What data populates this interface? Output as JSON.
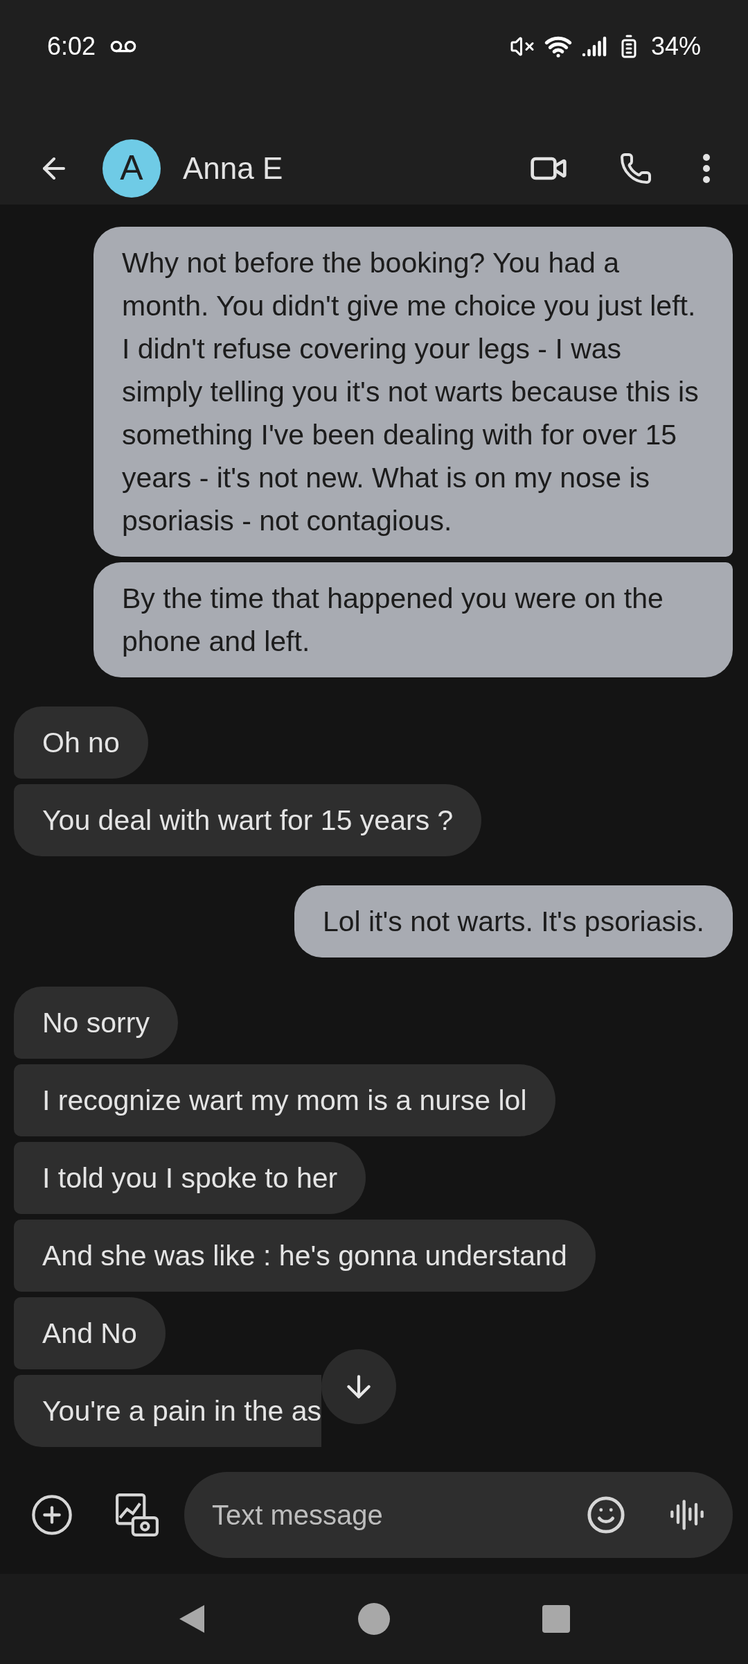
{
  "status_bar": {
    "time": "6:02",
    "battery": "34%"
  },
  "header": {
    "avatar_letter": "A",
    "contact_name": "Anna E"
  },
  "conversation": [
    {
      "kind": "sent",
      "messages": [
        "Why not before the booking? You had a month. You didn't give me choice you just left. I didn't refuse covering your legs - I was simply telling you it's not warts because this is something I've been dealing with for over 15 years - it's not new. What is on my nose is psoriasis - not contagious.",
        "By the time that happened you were on the phone and left."
      ]
    },
    {
      "kind": "received",
      "messages": [
        "Oh no",
        "You deal with wart for 15 years ?"
      ]
    },
    {
      "kind": "sent",
      "messages": [
        "Lol it's not warts. It's psoriasis."
      ]
    },
    {
      "kind": "received",
      "messages": [
        "No sorry",
        "I recognize wart my mom is a nurse lol",
        "I told you I spoke to her",
        "And she was like : he's gonna understand",
        "And No",
        "You're a pain in the as"
      ]
    }
  ],
  "scroll_down_button": true,
  "compose": {
    "placeholder": "Text message"
  }
}
